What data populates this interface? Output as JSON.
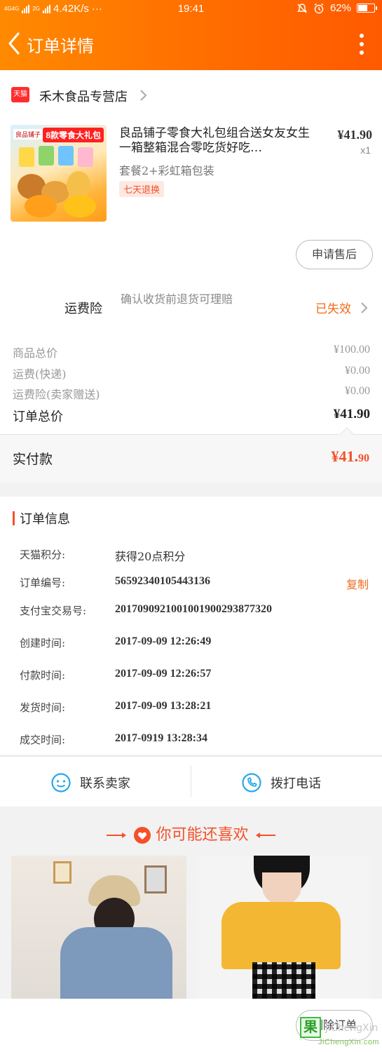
{
  "status_bar": {
    "signal1": "4G4G",
    "signal2": "2G",
    "net_speed": "4.42K/s",
    "dots": "···",
    "time": "19:41",
    "battery_pct": "62%",
    "battery_level": 0.62
  },
  "nav": {
    "title": "订单详情",
    "back_icon": "chevron-left-icon",
    "more_icon": "more-vertical-icon"
  },
  "shop": {
    "badge": "天猫",
    "name": "禾木食品专营店"
  },
  "product": {
    "image_tag": "8款零食大礼包",
    "image_brand": "良品铺子",
    "title": "良品铺子零食大礼包组合送女友女生一箱整箱混合零吃货好吃…",
    "price": "¥41.90",
    "qty": "x1",
    "spec": "套餐2+彩虹箱包装",
    "badge": "七天退换",
    "after_sale_label": "申请售后"
  },
  "insurance": {
    "label": "运费险",
    "desc": "确认收货前退货可理赔",
    "status": "已失效"
  },
  "costs": [
    {
      "label": "商品总价",
      "value": "¥100.00"
    },
    {
      "label": "运费(快递)",
      "value": "¥0.00"
    },
    {
      "label": "运费险(卖家赠送)",
      "value": "¥0.00"
    }
  ],
  "order_total": {
    "label": "订单总价",
    "value": "¥41.90"
  },
  "paid": {
    "label": "实付款",
    "value_main": "¥41.",
    "value_decimal": "90"
  },
  "order_info": {
    "heading": "订单信息",
    "rows": [
      {
        "key": "天猫积分:",
        "value": "获得20点积分"
      },
      {
        "key": "订单编号:",
        "value": "56592340105443136",
        "action": "复制"
      },
      {
        "key": "支付宝交易号:",
        "value": "2017090921001001900293877320"
      },
      {
        "key": "创建时间:",
        "value": "2017-09-09 12:26:49"
      },
      {
        "key": "付款时间:",
        "value": "2017-09-09 12:26:57"
      },
      {
        "key": "发货时间:",
        "value": "2017-09-09 13:28:21"
      },
      {
        "key": "成交时间:",
        "value": "2017-0919 13:28:34"
      }
    ]
  },
  "actions": {
    "contact_seller": "联系卖家",
    "call": "拨打电话"
  },
  "recommend": {
    "title": "你可能还喜欢"
  },
  "bottom": {
    "delete_label": "删除订单"
  },
  "watermark": {
    "box": "果",
    "name": "JiChengXin",
    "url": "JiChengXin.com"
  },
  "colors": {
    "accent": "#ff6a00",
    "price_red": "#f5502a",
    "link_orange": "#f06a1a"
  }
}
